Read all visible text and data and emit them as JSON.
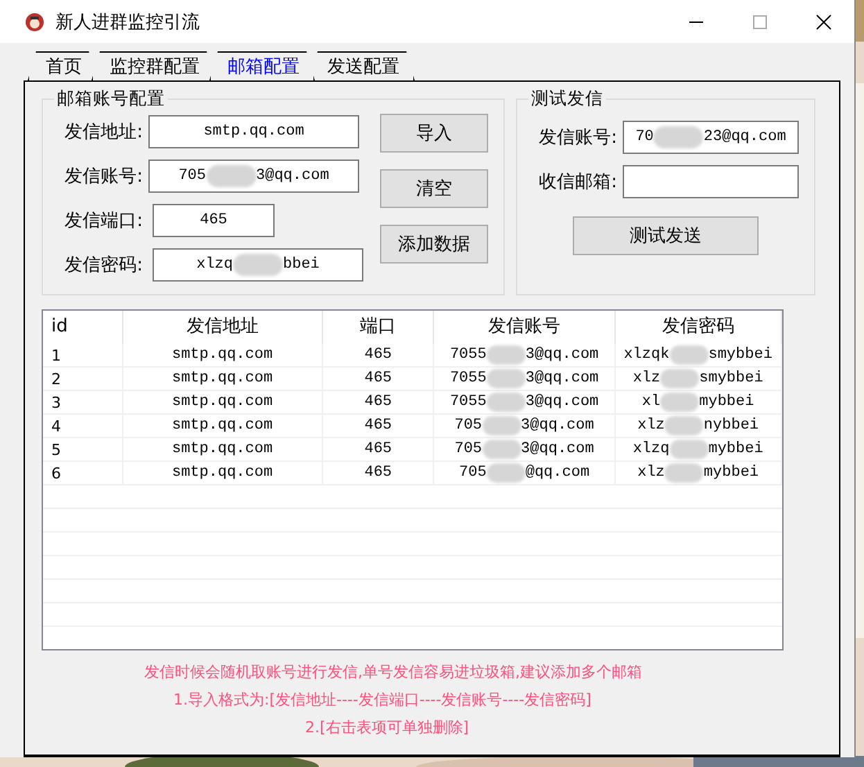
{
  "window": {
    "title": "新人进群监控引流"
  },
  "tabs": [
    {
      "label": "首页",
      "selected": false
    },
    {
      "label": "监控群配置",
      "selected": false
    },
    {
      "label": "邮箱配置",
      "selected": true
    },
    {
      "label": "发送配置",
      "selected": false
    }
  ],
  "account_config": {
    "title": "邮箱账号配置",
    "fields": [
      {
        "label": "发信地址:",
        "value": [
          "smtp.qq.com"
        ]
      },
      {
        "label": "发信账号:",
        "value": [
          "705",
          "3@qq.com"
        ]
      },
      {
        "label": "发信端口:",
        "value": [
          "465"
        ]
      },
      {
        "label": "发信密码:",
        "value": [
          "xlzq",
          "bbei"
        ]
      }
    ],
    "buttons": [
      "导入",
      "清空",
      "添加数据"
    ]
  },
  "test_send": {
    "title": "测试发信",
    "fields": [
      {
        "label": "发信账号:",
        "value": [
          "70",
          "23@qq.com"
        ]
      },
      {
        "label": "收信邮箱:"
      }
    ],
    "button": "测试发送"
  },
  "table": {
    "columns": [
      "id",
      "发信地址",
      "端口",
      "发信账号",
      "发信密码"
    ],
    "rows": [
      {
        "id": "1",
        "address": "smtp.qq.com",
        "port": "465",
        "account": [
          "7055",
          "3@qq.com"
        ],
        "password": [
          "xlzqk",
          "smybbei"
        ]
      },
      {
        "id": "2",
        "address": "smtp.qq.com",
        "port": "465",
        "account": [
          "7055",
          "3@qq.com"
        ],
        "password": [
          "xlz",
          "smybbei"
        ]
      },
      {
        "id": "3",
        "address": "smtp.qq.com",
        "port": "465",
        "account": [
          "7055",
          "3@qq.com"
        ],
        "password": [
          "xl",
          "mybbei"
        ]
      },
      {
        "id": "4",
        "address": "smtp.qq.com",
        "port": "465",
        "account": [
          "705",
          "3@qq.com"
        ],
        "password": [
          "xlz",
          "nybbei"
        ]
      },
      {
        "id": "5",
        "address": "smtp.qq.com",
        "port": "465",
        "account": [
          "705",
          "3@qq.com"
        ],
        "password": [
          "xlzq",
          "mybbei"
        ]
      },
      {
        "id": "6",
        "address": "smtp.qq.com",
        "port": "465",
        "account": [
          "705",
          "@qq.com"
        ],
        "password": [
          "xlz",
          "mybbei"
        ]
      }
    ]
  },
  "notes": [
    "发信时候会随机取账号进行发信,单号发信容易进垃圾箱,建议添加多个邮箱",
    "1.导入格式为:[发信地址----发信端口----发信账号----发信密码]",
    "2.[右击表项可单独删除]"
  ]
}
